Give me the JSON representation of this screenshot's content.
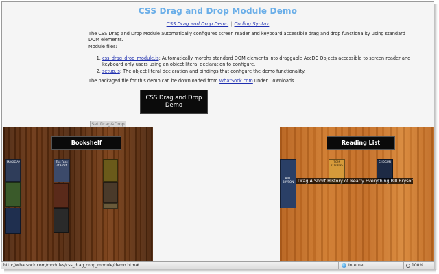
{
  "page": {
    "title": "CSS Drag and Drop Module Demo",
    "links": [
      "CSS Drag and Drop Demo",
      "Coding Syntax"
    ],
    "link_separator": "|",
    "intro": "The CSS Drag and Drop Module automatically configures screen reader and keyboard accessible drag and drop functionality using standard DOM elements.",
    "modules_label": "Module files:",
    "files": [
      {
        "link": "css_drag_drop_module.js",
        "text": ": Automatically morphs standard DOM elements into draggable AccDC Objects accessible to screen reader and keyboard only users using an object literal declaration to configure."
      },
      {
        "link": "setup.js",
        "text": ": The object literal declaration and bindings that configure the demo functionality."
      }
    ],
    "packaged_prefix": "The packaged file for this demo can be downloaded from ",
    "packaged_link": "WhatSock.com",
    "packaged_suffix": " under Downloads."
  },
  "demo_button": {
    "label": "CSS Drag and Drop Demo"
  },
  "set_button": {
    "label": "Set Drag&Drop"
  },
  "bookshelf": {
    "heading": "Bookshelf",
    "books": [
      {
        "title": "MAGICIANS",
        "color": "#2f3d5a"
      },
      {
        "title": "",
        "color": "#3a5a2a"
      },
      {
        "title": "",
        "color": "#8a6a2a"
      },
      {
        "title": "",
        "color": "#1f2f4f"
      },
      {
        "title": "The Face of Frost",
        "color": "#3c4a6a"
      },
      {
        "title": "",
        "color": "#5a2a1a"
      },
      {
        "title": "",
        "color": "#6a5a1a"
      },
      {
        "title": "",
        "color": "#2a2a2a"
      },
      {
        "title": "",
        "color": "#4a3a2a"
      },
      {
        "title": "",
        "color": "#6a5a3a"
      },
      {
        "title": "",
        "color": "#2a2a2a"
      }
    ]
  },
  "reading_list": {
    "heading": "Reading List",
    "books": [
      {
        "title": "BILL BRYSON",
        "color": "#2a3f66"
      },
      {
        "title": "TOM ROBBINS",
        "color": "#d59a3a"
      },
      {
        "title": "SHOGUN",
        "color": "#1d2a44"
      }
    ],
    "caption": "Drag A Short History of Nearly Everything Bill Bryson"
  },
  "status": {
    "url": "http://whatsock.com/modules/css_drag_drop_module/demo.htm#",
    "zone": "Internet",
    "zoom": "100%"
  }
}
